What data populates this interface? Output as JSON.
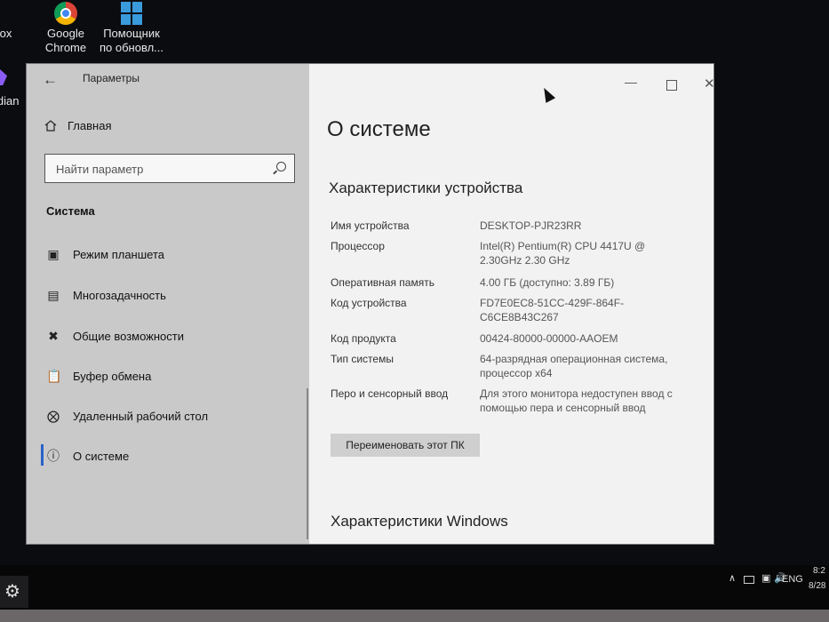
{
  "desktop": {
    "icons": [
      {
        "label": "fox",
        "icon": "firefox-icon"
      },
      {
        "label": "Google\nChrome",
        "icon": "chrome-icon"
      },
      {
        "label": "Помощник\nпо обновл...",
        "icon": "windows-update-icon"
      },
      {
        "label": "idian",
        "icon": "obsidian-icon"
      }
    ]
  },
  "window": {
    "app_title": "Параметры",
    "sidebar": {
      "home_label": "Главная",
      "search_placeholder": "Найти параметр",
      "section": "Система",
      "items": [
        {
          "label": "Режим планшета",
          "icon": "tablet-mode-icon"
        },
        {
          "label": "Многозадачность",
          "icon": "multitasking-icon"
        },
        {
          "label": "Общие возможности",
          "icon": "shared-experiences-icon"
        },
        {
          "label": "Буфер обмена",
          "icon": "clipboard-icon"
        },
        {
          "label": "Удаленный рабочий стол",
          "icon": "remote-desktop-icon"
        },
        {
          "label": "О системе",
          "icon": "info-icon",
          "active": true
        }
      ]
    },
    "content": {
      "page_title": "О системе",
      "device_specs_title": "Характеристики устройства",
      "specs": [
        {
          "key": "Имя устройства",
          "value": "DESKTOP-PJR23RR"
        },
        {
          "key": "Процессор",
          "value": "Intel(R) Pentium(R) CPU 4417U @\n2.30GHz   2.30 GHz"
        },
        {
          "key": "Оперативная память",
          "value": "4.00 ГБ (доступно: 3.89 ГБ)"
        },
        {
          "key": "Код устройства",
          "value": "FD7E0EC8-51CC-429F-864F-\nC6CE8B43C267"
        },
        {
          "key": "Код продукта",
          "value": "00424-80000-00000-AAOEM"
        },
        {
          "key": "Тип системы",
          "value": "64-разрядная операционная система,\nпроцессор x64"
        },
        {
          "key": "Перо и сенсорный ввод",
          "value": "Для этого монитора недоступен ввод с\nпомощью пера и сенсорный ввод"
        }
      ],
      "rename_button": "Переименовать этот ПК",
      "windows_specs_title": "Характеристики Windows"
    }
  },
  "taskbar": {
    "language": "ENG",
    "time": "8:2",
    "date": "8/28"
  },
  "colors": {
    "sidebar_bg": "#c9c9c9",
    "content_bg": "#f2f2f2",
    "accent": "#2a62c9"
  }
}
